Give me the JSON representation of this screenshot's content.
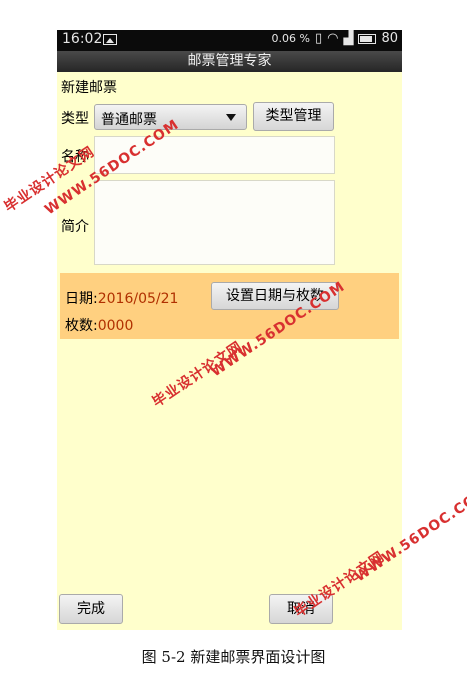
{
  "status_bar": {
    "time": "16:02",
    "speed": "0.06",
    "speed_unit": "%",
    "battery": "80"
  },
  "app": {
    "title": "邮票管理专家"
  },
  "form": {
    "section_title": "新建邮票",
    "type_label": "类型",
    "type_value": "普通邮票",
    "type_manage_button": "类型管理",
    "name_label": "名称",
    "name_value": "",
    "intro_label": "简介",
    "intro_value": "",
    "date_label": "日期:",
    "date_value": "2016/05/21",
    "count_label": "枚数:",
    "count_value": "0000",
    "set_date_button": "设置日期与枚数",
    "done_button": "完成",
    "cancel_button": "取消"
  },
  "watermark": {
    "line1": "毕业设计论文网",
    "line2": "WWW.56DOC.COM",
    "color": "#d83030"
  },
  "caption": "图 5-2 新建邮票界面设计图"
}
